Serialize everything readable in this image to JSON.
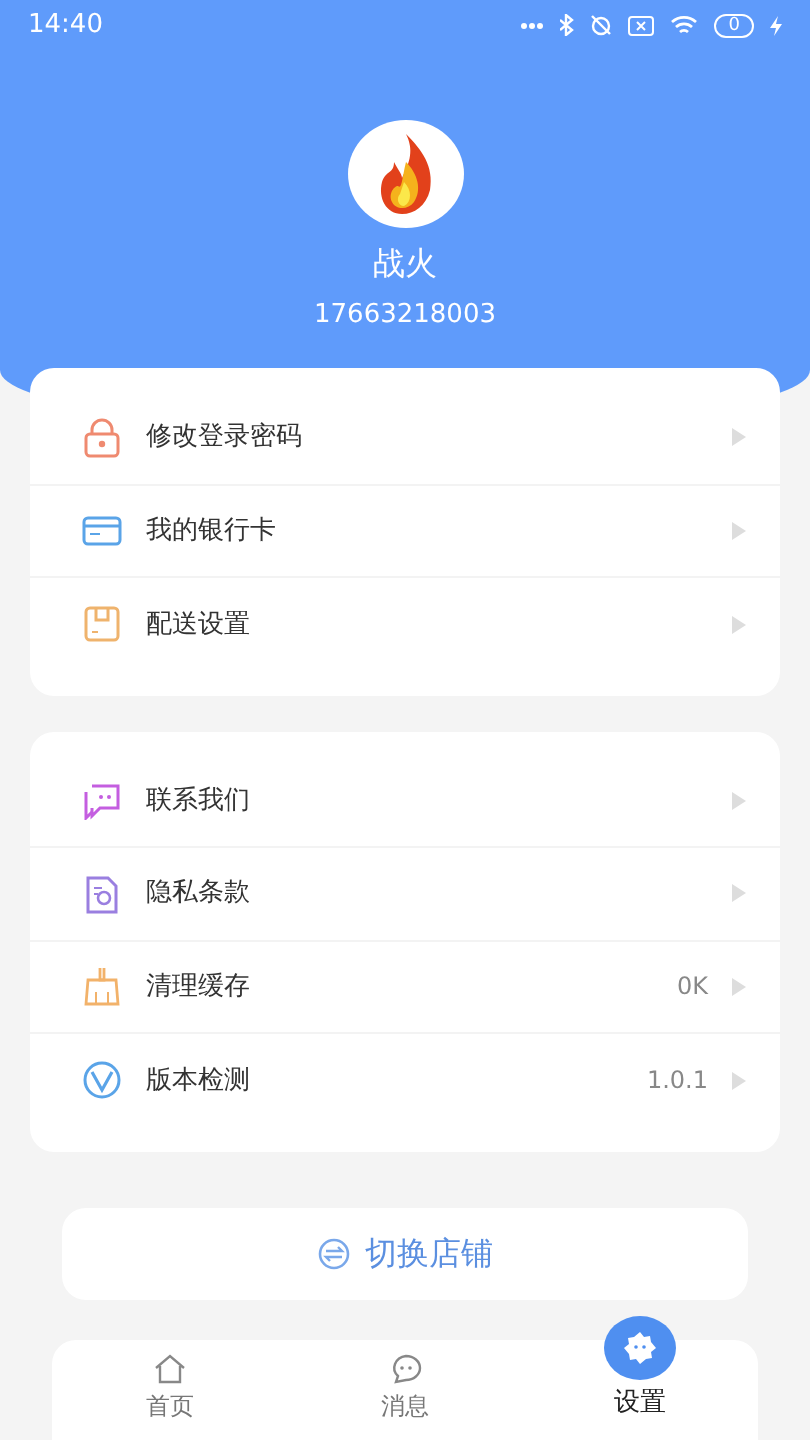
{
  "status_bar": {
    "time": "14:40",
    "battery": "0"
  },
  "profile": {
    "name": "战火",
    "phone": "17663218003"
  },
  "groups": [
    {
      "items": [
        {
          "label": "修改登录密码"
        },
        {
          "label": "我的银行卡"
        },
        {
          "label": "配送设置"
        }
      ]
    },
    {
      "items": [
        {
          "label": "联系我们"
        },
        {
          "label": "隐私条款"
        },
        {
          "label": "清理缓存",
          "value": "0K"
        },
        {
          "label": "版本检测",
          "value": "1.0.1"
        }
      ]
    }
  ],
  "switch_button": {
    "label": "切换店铺"
  },
  "tabs": [
    {
      "label": "首页",
      "selected": false
    },
    {
      "label": "消息",
      "selected": false
    },
    {
      "label": "设置",
      "selected": true
    }
  ]
}
